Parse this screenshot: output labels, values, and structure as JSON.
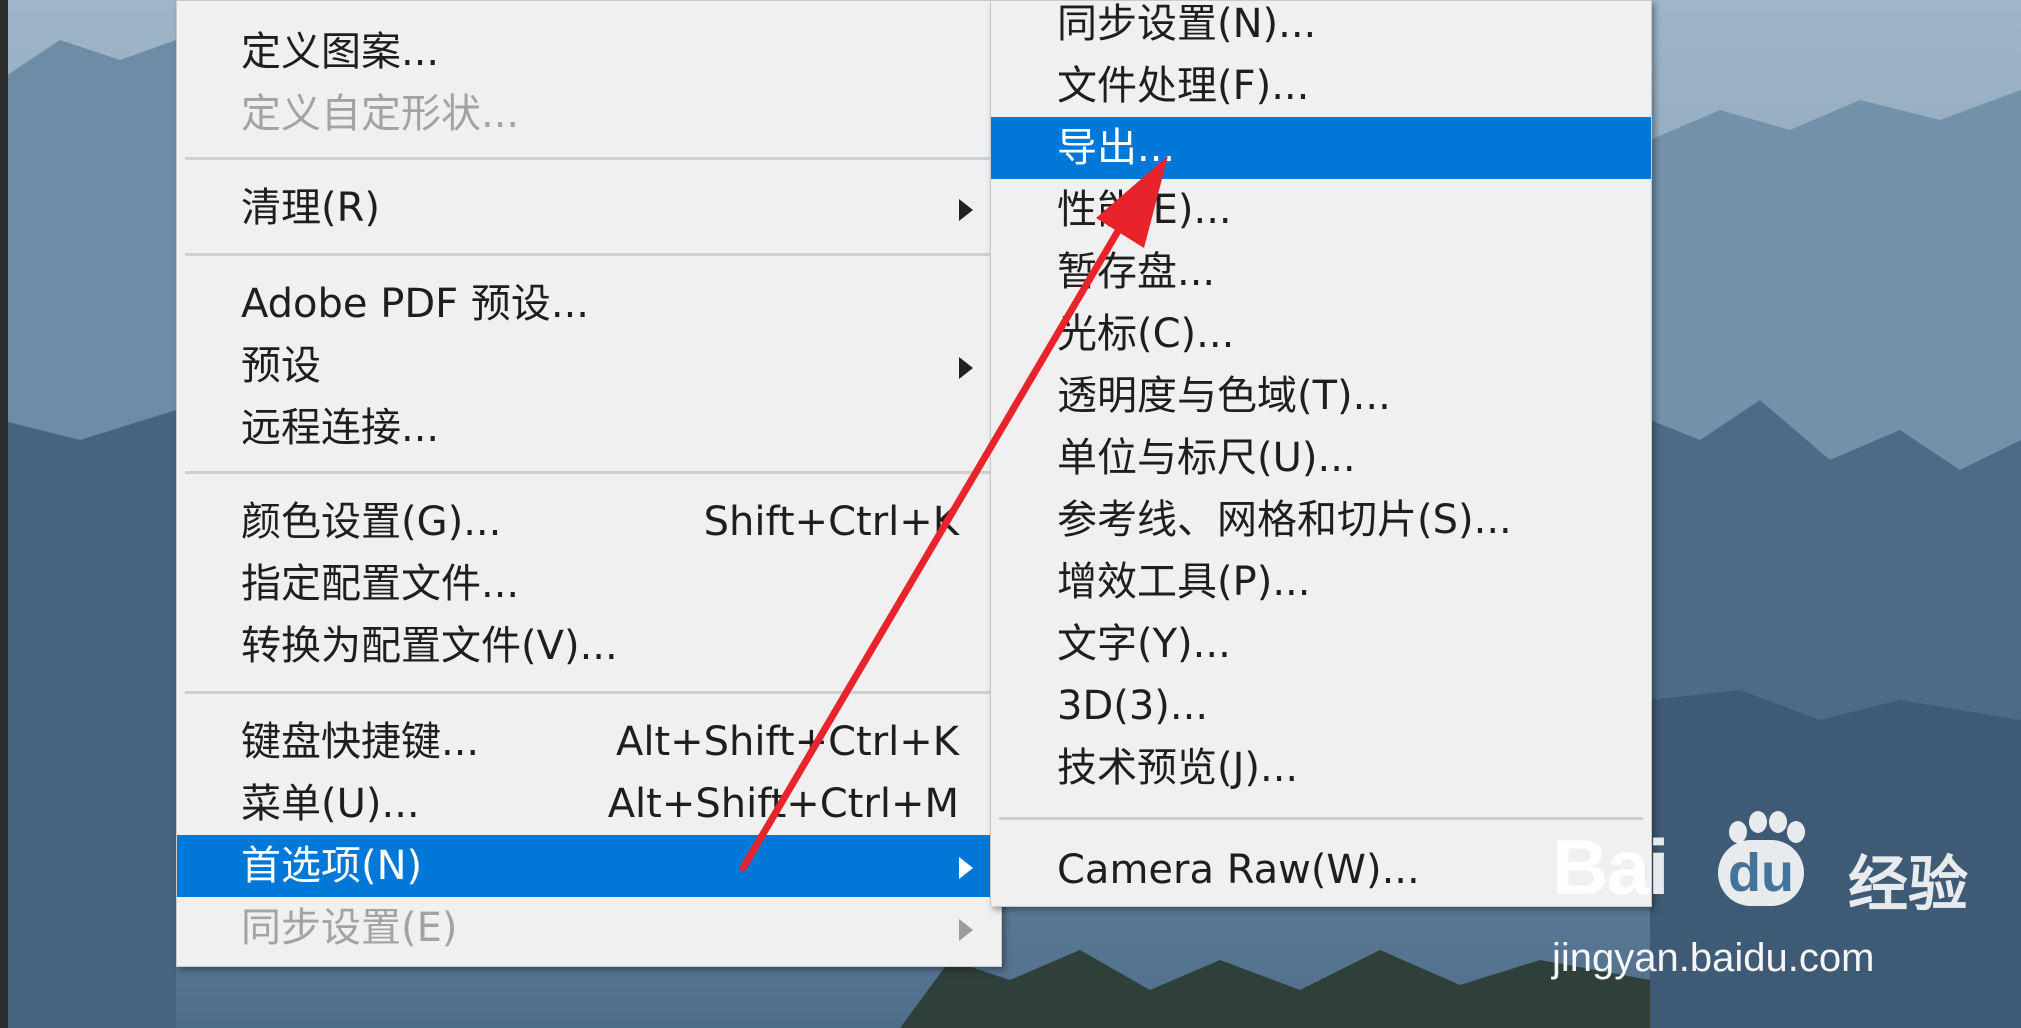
{
  "main_menu": {
    "items": [
      {
        "label": "定义图案...",
        "disabled": false
      },
      {
        "label": "定义自定形状...",
        "disabled": true
      },
      {
        "label": "清理(R)",
        "submenu": true
      },
      {
        "label": "Adobe PDF 预设..."
      },
      {
        "label": "预设",
        "submenu": true
      },
      {
        "label": "远程连接..."
      },
      {
        "label": "颜色设置(G)...",
        "shortcut": "Shift+Ctrl+K"
      },
      {
        "label": "指定配置文件..."
      },
      {
        "label": "转换为配置文件(V)..."
      },
      {
        "label": "键盘快捷键...",
        "shortcut": "Alt+Shift+Ctrl+K"
      },
      {
        "label": "菜单(U)...",
        "shortcut": "Alt+Shift+Ctrl+M"
      },
      {
        "label": "首选项(N)",
        "submenu": true,
        "selected": true
      },
      {
        "label": "同步设置(E)",
        "submenu": true,
        "disabled": true
      }
    ]
  },
  "sub_menu": {
    "items": [
      {
        "label": "同步设置(N)..."
      },
      {
        "label": "文件处理(F)..."
      },
      {
        "label": "导出...",
        "selected": true
      },
      {
        "label": "性能(E)..."
      },
      {
        "label": "暂存盘..."
      },
      {
        "label": "光标(C)..."
      },
      {
        "label": "透明度与色域(T)..."
      },
      {
        "label": "单位与标尺(U)..."
      },
      {
        "label": "参考线、网格和切片(S)..."
      },
      {
        "label": "增效工具(P)..."
      },
      {
        "label": "文字(Y)..."
      },
      {
        "label": "3D(3)..."
      },
      {
        "label": "技术预览(J)..."
      },
      {
        "label": "Camera Raw(W)..."
      }
    ]
  },
  "watermark": {
    "brand": "Bai",
    "brand_du": "du",
    "brand_cn": "经验",
    "url": "jingyan.baidu.com"
  },
  "colors": {
    "menu_bg": "#f0f0f0",
    "highlight": "#0078d7",
    "disabled_text": "#a3a3a3",
    "annotation_arrow": "#e8232b"
  }
}
